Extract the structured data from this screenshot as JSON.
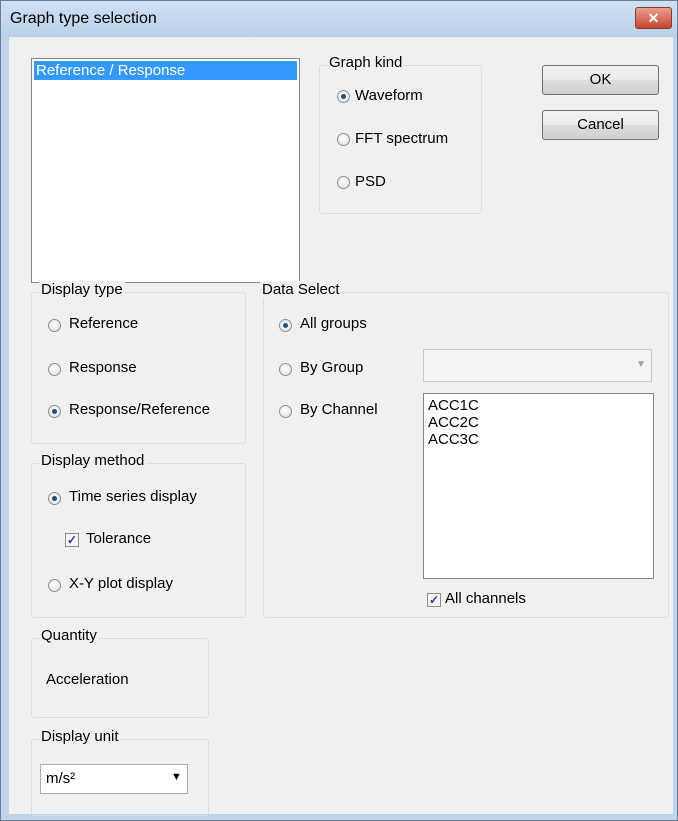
{
  "window": {
    "title": "Graph type selection",
    "close_glyph": "✕"
  },
  "graph_list": {
    "items": [
      "Reference / Response"
    ],
    "selected_index": 0
  },
  "graph_kind": {
    "legend": "Graph kind",
    "options": [
      "Waveform",
      "FFT spectrum",
      "PSD"
    ],
    "selected": "Waveform"
  },
  "buttons": {
    "ok": "OK",
    "cancel": "Cancel"
  },
  "display_type": {
    "legend": "Display type",
    "options": [
      "Reference",
      "Response",
      "Response/Reference"
    ],
    "selected": "Response/Reference"
  },
  "display_method": {
    "legend": "Display method",
    "time_series": "Time series display",
    "tolerance": "Tolerance",
    "tolerance_checked": true,
    "xy_plot": "X-Y plot display",
    "selected": "Time series display"
  },
  "quantity": {
    "legend": "Quantity",
    "value": "Acceleration"
  },
  "display_unit": {
    "legend": "Display unit",
    "value": "m/s²"
  },
  "data_select": {
    "legend": "Data Select",
    "all_groups": "All groups",
    "by_group": "By Group",
    "by_channel": "By Channel",
    "selected": "All groups",
    "group_value": "",
    "channels": [
      "ACC1C",
      "ACC2C",
      "ACC3C"
    ],
    "all_channels": "All channels",
    "all_channels_checked": true
  },
  "icons": {
    "dropdown": "chevron-down-icon",
    "checkmark": "checkmark-icon",
    "close": "close-icon"
  }
}
